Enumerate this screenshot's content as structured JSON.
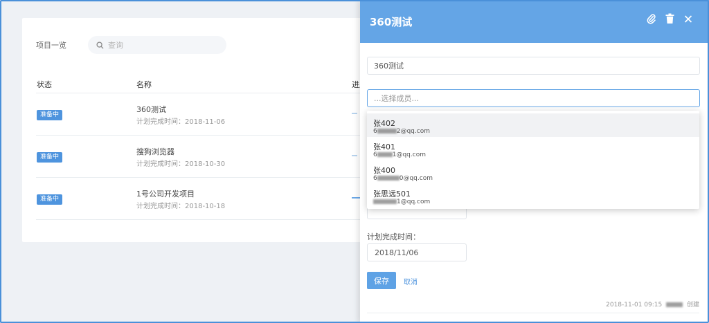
{
  "list": {
    "title": "项目一览",
    "search_placeholder": "查询",
    "columns": [
      "状态",
      "名称",
      "进度"
    ],
    "rows": [
      {
        "status": "准备中",
        "name": "360测试",
        "date": "计划完成时间：2018-11-06"
      },
      {
        "status": "准备中",
        "name": "搜狗浏览器",
        "date": "计划完成时间：2018-10-30"
      },
      {
        "status": "准备中",
        "name": "1号公司开发项目",
        "date": "计划完成时间：2018-10-18"
      }
    ]
  },
  "drawer": {
    "title": "360测试",
    "icons": [
      "paperclip-icon",
      "trash-icon",
      "close-icon"
    ],
    "name_value": "360测试",
    "member_placeholder": "...选择成员...",
    "members": [
      {
        "name": "张402",
        "email_prefix": "6",
        "email_suffix": "2@qq.com"
      },
      {
        "name": "张401",
        "email_prefix": "6",
        "email_suffix": "1@qq.com"
      },
      {
        "name": "张400",
        "email_prefix": "6",
        "email_suffix": "0@qq.com"
      },
      {
        "name": "张思远501",
        "email_prefix": "",
        "email_suffix": "1@qq.com"
      }
    ],
    "due_label": "计划完成时间：",
    "due_value": "2018/11/06",
    "save_label": "保存",
    "cancel_label": "取消",
    "meta_time": "2018-11-01 09:15",
    "meta_action": "创建"
  },
  "colors": {
    "accent": "#64a5e6",
    "badge": "#4e94de"
  }
}
